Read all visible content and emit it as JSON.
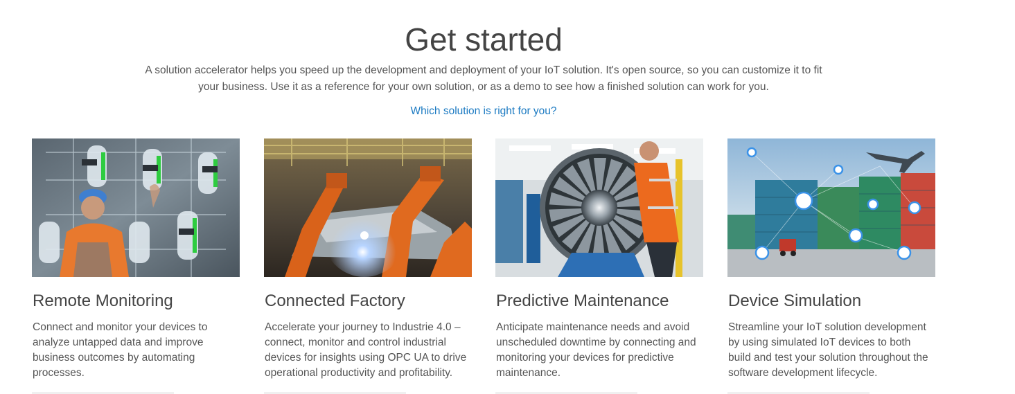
{
  "header": {
    "title": "Get started",
    "intro": "A solution accelerator helps you speed up the development and deployment of your IoT solution. It's open source, so you can customize it to fit your business. Use it as a reference for your own solution, or as a demo to see how a finished solution can work for you.",
    "link_label": "Which solution is right for you?",
    "link_color": "#1b7ac2"
  },
  "cards": [
    {
      "title": "Remote Monitoring",
      "description": "Connect and monitor your devices to analyze untapped data and improve business outcomes by automating processes."
    },
    {
      "title": "Connected Factory",
      "description": "Accelerate your journey to Industrie 4.0 – connect, monitor and control industrial devices for insights using OPC UA to drive operational productivity and profitability."
    },
    {
      "title": "Predictive Maintenance",
      "description": "Anticipate maintenance needs and avoid unscheduled downtime by connecting and monitoring your devices for predictive maintenance."
    },
    {
      "title": "Device Simulation",
      "description": "Streamline your IoT solution development by using simulated IoT devices to both build and test your solution throughout the software development lifecycle."
    }
  ]
}
